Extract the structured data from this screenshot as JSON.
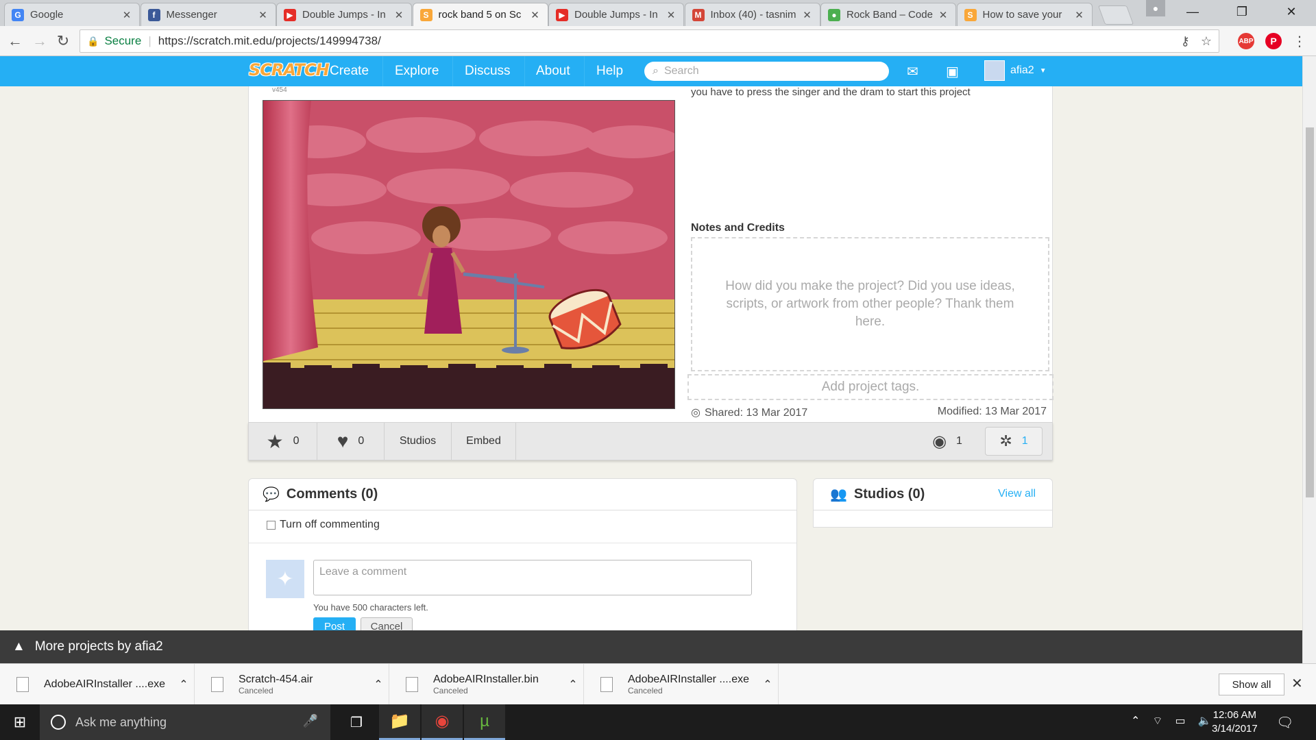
{
  "tabs": [
    {
      "title": "Google",
      "icon": "google-icon",
      "color": "#4285f4",
      "glyph": "G"
    },
    {
      "title": "Messenger",
      "icon": "facebook-icon",
      "color": "#3b5998",
      "glyph": "f"
    },
    {
      "title": "Double Jumps - In",
      "icon": "youtube-icon",
      "color": "#e52d27",
      "glyph": "▶"
    },
    {
      "title": "rock band 5 on Sc",
      "icon": "scratch-icon",
      "color": "#f9a739",
      "glyph": "S",
      "active": true
    },
    {
      "title": "Double Jumps - In",
      "icon": "youtube-icon",
      "color": "#e52d27",
      "glyph": "▶"
    },
    {
      "title": "Inbox (40) - tasnim",
      "icon": "gmail-icon",
      "color": "#d44638",
      "glyph": "M"
    },
    {
      "title": "Rock Band – Code",
      "icon": "code-icon",
      "color": "#4caf50",
      "glyph": "●"
    },
    {
      "title": "How to save your",
      "icon": "scratch-icon",
      "color": "#f9a739",
      "glyph": "S"
    }
  ],
  "address": {
    "secure_label": "Secure",
    "url": "https://scratch.mit.edu/projects/149994738/"
  },
  "nav": {
    "logo": "SCRATCH",
    "links": [
      "Create",
      "Explore",
      "Discuss",
      "About",
      "Help"
    ],
    "search_placeholder": "Search",
    "username": "afia2"
  },
  "project": {
    "version": "v454",
    "instructions": "you have to press the singer and the dram to start this project",
    "notes_title": "Notes and Credits",
    "notes_placeholder": "How did you make the project? Did you use ideas, scripts, or artwork from other people? Thank them here.",
    "tags_placeholder": "Add project tags.",
    "shared": "Shared: 13 Mar 2017",
    "modified": "Modified: 13 Mar 2017"
  },
  "stats": {
    "favorites": "0",
    "loves": "0",
    "studios_label": "Studios",
    "embed_label": "Embed",
    "views": "1",
    "remixes": "1"
  },
  "comments": {
    "title": "Comments (0)",
    "turn_off_label": "Turn off commenting",
    "input_placeholder": "Leave a comment",
    "chars_left": "You have 500 characters left.",
    "post_label": "Post",
    "cancel_label": "Cancel"
  },
  "studios": {
    "title": "Studios (0)",
    "view_all": "View all"
  },
  "more_projects": "More projects by afia2",
  "downloads": [
    {
      "name": "AdobeAIRInstaller ....exe",
      "status": ""
    },
    {
      "name": "Scratch-454.air",
      "status": "Canceled"
    },
    {
      "name": "AdobeAIRInstaller.bin",
      "status": "Canceled"
    },
    {
      "name": "AdobeAIRInstaller ....exe",
      "status": "Canceled"
    }
  ],
  "show_all": "Show all",
  "taskbar": {
    "search_placeholder": "Ask me anything",
    "time": "12:06 AM",
    "date": "3/14/2017"
  }
}
